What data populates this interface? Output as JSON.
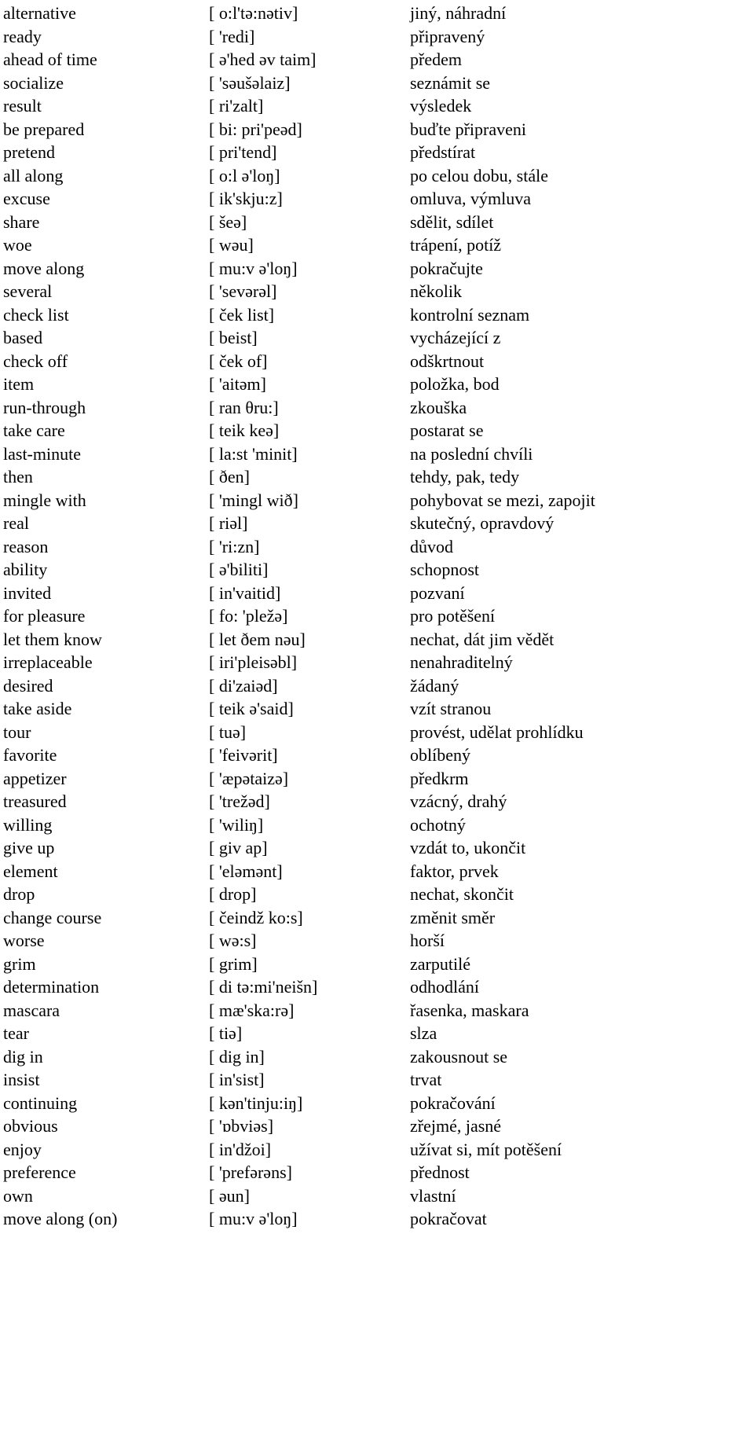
{
  "document": {
    "kind": "vocabulary-list",
    "columns": [
      "term",
      "phonetic",
      "translation"
    ],
    "row_count": 53
  },
  "rows": [
    {
      "term": "alternative",
      "phonetic": "[ o:l'tə:nətiv]",
      "translation": "jiný, náhradní"
    },
    {
      "term": "ready",
      "phonetic": "[ 'redi]",
      "translation": "připravený"
    },
    {
      "term": "ahead of time",
      "phonetic": "[ ə'hed əv taim]",
      "translation": "předem"
    },
    {
      "term": "socialize",
      "phonetic": "[ 'səušəlaiz]",
      "translation": "seznámit se"
    },
    {
      "term": "result",
      "phonetic": "[ ri'zalt]",
      "translation": "výsledek"
    },
    {
      "term": "be prepared",
      "phonetic": "[ bi: pri'peəd]",
      "translation": "buďte připraveni"
    },
    {
      "term": "pretend",
      "phonetic": "[ pri'tend]",
      "translation": "předstírat"
    },
    {
      "term": "all along",
      "phonetic": "[ o:l ə'loŋ]",
      "translation": "po celou dobu, stále"
    },
    {
      "term": "excuse",
      "phonetic": "[ ik'skju:z]",
      "translation": "omluva, výmluva"
    },
    {
      "term": "share",
      "phonetic": "[ šeə]",
      "translation": "sdělit, sdílet"
    },
    {
      "term": "woe",
      "phonetic": "[ wəu]",
      "translation": "trápení, potíž"
    },
    {
      "term": "move along",
      "phonetic": "[ mu:v ə'loŋ]",
      "translation": "pokračujte"
    },
    {
      "term": "several",
      "phonetic": "[ 'sevərəl]",
      "translation": "několik"
    },
    {
      "term": "check list",
      "phonetic": "[ ček list]",
      "translation": "kontrolní seznam"
    },
    {
      "term": "based",
      "phonetic": "[ beist]",
      "translation": "vycházející z"
    },
    {
      "term": "check off",
      "phonetic": "[ ček of]",
      "translation": "odškrtnout"
    },
    {
      "term": "item",
      "phonetic": "[ 'aitəm]",
      "translation": "položka, bod"
    },
    {
      "term": "run-through",
      "phonetic": "[ ran θru:]",
      "translation": "zkouška"
    },
    {
      "term": "take care",
      "phonetic": "[ teik keə]",
      "translation": "postarat se"
    },
    {
      "term": "last-minute",
      "phonetic": "[ la:st 'minit]",
      "translation": "na poslední chvíli"
    },
    {
      "term": "then",
      "phonetic": "[ ðen]",
      "translation": "tehdy, pak, tedy"
    },
    {
      "term": "mingle with",
      "phonetic": "[ 'mingl wið]",
      "translation": "pohybovat se mezi, zapojit"
    },
    {
      "term": "real",
      "phonetic": "[ riəl]",
      "translation": "skutečný, opravdový"
    },
    {
      "term": "reason",
      "phonetic": "[ 'ri:zn]",
      "translation": "důvod"
    },
    {
      "term": "ability",
      "phonetic": "[ ə'biliti]",
      "translation": "schopnost"
    },
    {
      "term": "invited",
      "phonetic": "[ in'vaitid]",
      "translation": "pozvaní"
    },
    {
      "term": "for pleasure",
      "phonetic": "[ fo: 'pležə]",
      "translation": "pro potěšení"
    },
    {
      "term": "let them know",
      "phonetic": "[ let ðem nəu]",
      "translation": "nechat, dát jim vědět"
    },
    {
      "term": "irreplaceable",
      "phonetic": "[ iri'pleisəbl]",
      "translation": "nenahraditelný"
    },
    {
      "term": "desired",
      "phonetic": "[ di'zaiəd]",
      "translation": "žádaný"
    },
    {
      "term": "take aside",
      "phonetic": "[ teik ə'said]",
      "translation": "vzít stranou"
    },
    {
      "term": "tour",
      "phonetic": "[ tuə]",
      "translation": "provést, udělat prohlídku"
    },
    {
      "term": "favorite",
      "phonetic": "[ 'feivərit]",
      "translation": "oblíbený"
    },
    {
      "term": "appetizer",
      "phonetic": "[ 'æpətaizə]",
      "translation": "předkrm"
    },
    {
      "term": "treasured",
      "phonetic": "[ 'trežəd]",
      "translation": "vzácný, drahý"
    },
    {
      "term": "willing",
      "phonetic": "[ 'wiliŋ]",
      "translation": "ochotný"
    },
    {
      "term": "give up",
      "phonetic": "[ giv ap]",
      "translation": "vzdát to, ukončit"
    },
    {
      "term": "element",
      "phonetic": "[ 'eləmənt]",
      "translation": "faktor, prvek"
    },
    {
      "term": "drop",
      "phonetic": "[ drop]",
      "translation": "nechat, skončit"
    },
    {
      "term": "change course",
      "phonetic": "[ čeindž ko:s]",
      "translation": "změnit směr"
    },
    {
      "term": "worse",
      "phonetic": "[ wə:s]",
      "translation": "horší"
    },
    {
      "term": "grim",
      "phonetic": "[ grim]",
      "translation": "zarputilé"
    },
    {
      "term": "determination",
      "phonetic": "[ di tə:mi'neišn]",
      "translation": "odhodlání"
    },
    {
      "term": "mascara",
      "phonetic": "[ mæ'ska:rə]",
      "translation": "řasenka, maskara"
    },
    {
      "term": "tear",
      "phonetic": "[ tiə]",
      "translation": "slza"
    },
    {
      "term": "dig in",
      "phonetic": "[ dig in]",
      "translation": "zakousnout se"
    },
    {
      "term": "insist",
      "phonetic": "[ in'sist]",
      "translation": "trvat"
    },
    {
      "term": "continuing",
      "phonetic": "[ kən'tinju:iŋ]",
      "translation": "pokračování"
    },
    {
      "term": "obvious",
      "phonetic": "[ 'ɒbviəs]",
      "translation": "zřejmé, jasné"
    },
    {
      "term": "enjoy",
      "phonetic": "[ in'džoi]",
      "translation": "užívat si, mít potěšení"
    },
    {
      "term": "preference",
      "phonetic": "[ 'prefərəns]",
      "translation": "přednost"
    },
    {
      "term": "own",
      "phonetic": "[ əun]",
      "translation": "vlastní"
    },
    {
      "term": "move along (on)",
      "phonetic": "[ mu:v ə'loŋ]",
      "translation": "pokračovat"
    }
  ]
}
